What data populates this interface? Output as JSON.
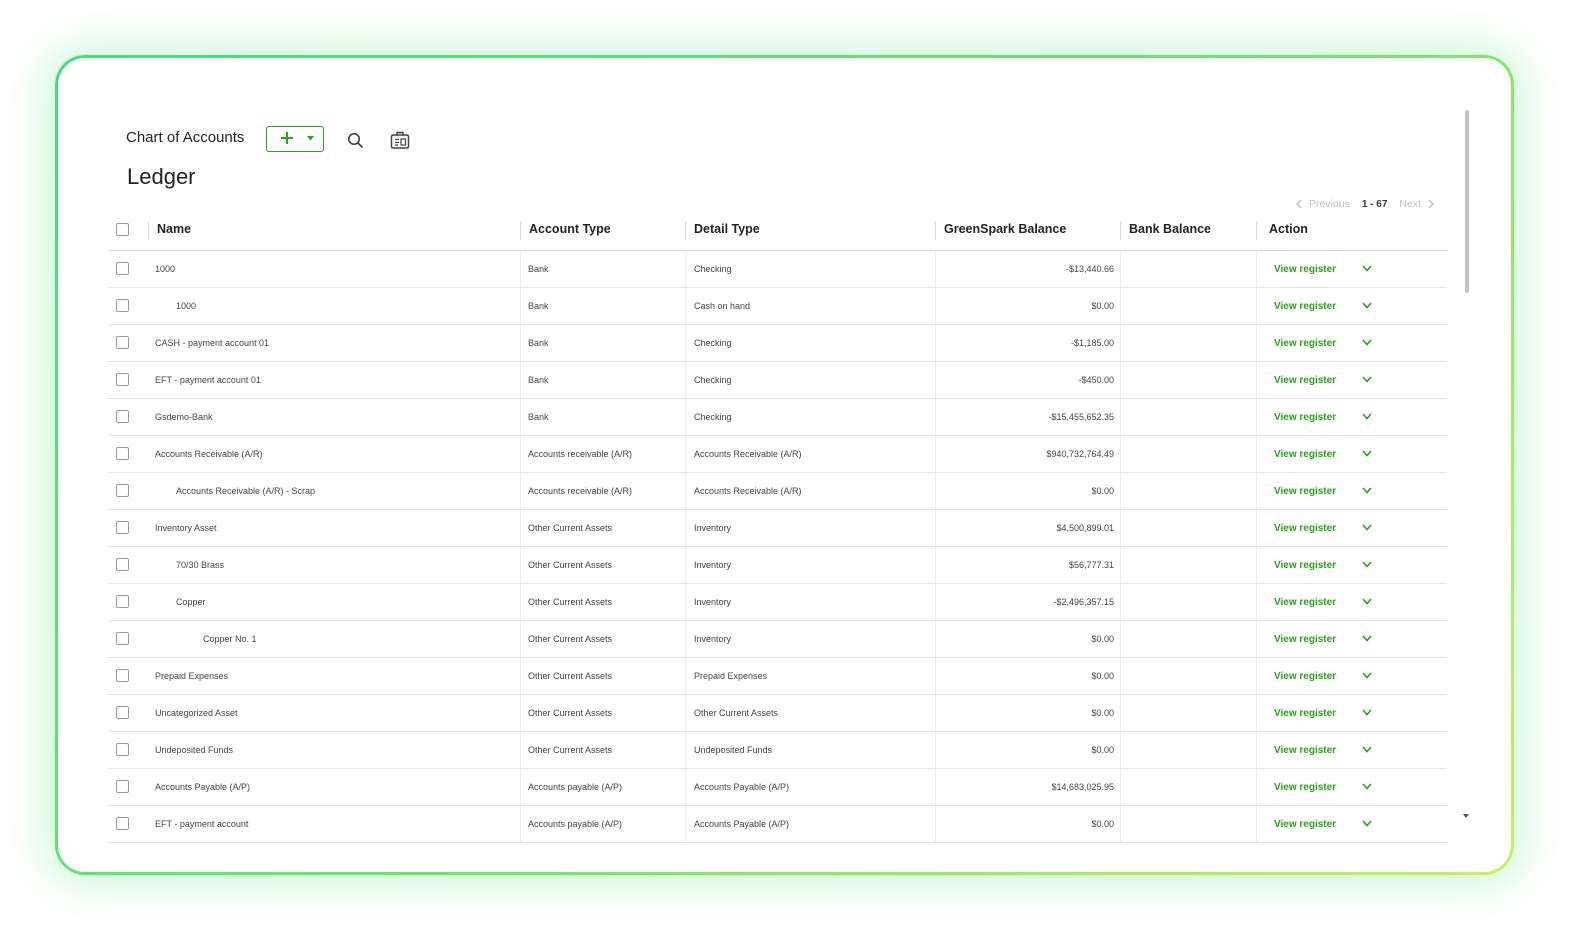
{
  "app_title": "Chart of Accounts",
  "page_title": "Ledger",
  "icons": {
    "new": "plus-icon",
    "new_dropdown": "caret-down-icon",
    "search": "search-icon",
    "report": "report-icon",
    "row_action": "chevron-down-icon"
  },
  "colors": {
    "accent_green": "#2ca01c",
    "frame_green": "#3ee07a",
    "frame_lime": "#c6f25a"
  },
  "pagination": {
    "previous": "Previous",
    "range": "1 - 67",
    "next": "Next"
  },
  "columns": {
    "name": "Name",
    "account_type": "Account Type",
    "detail_type": "Detail Type",
    "greenspark_balance": "GreenSpark Balance",
    "bank_balance": "Bank Balance",
    "action": "Action"
  },
  "rows": [
    {
      "name": "1000",
      "level": 0,
      "account_type": "Bank",
      "detail_type": "Checking",
      "balance": "-$13,440.66",
      "bank_balance": "",
      "action": "View register"
    },
    {
      "name": "1000",
      "level": 1,
      "account_type": "Bank",
      "detail_type": "Cash on hand",
      "balance": "$0.00",
      "bank_balance": "",
      "action": "View register"
    },
    {
      "name": "CASH - payment account 01",
      "level": 0,
      "account_type": "Bank",
      "detail_type": "Checking",
      "balance": "-$1,185.00",
      "bank_balance": "",
      "action": "View register"
    },
    {
      "name": "EFT - payment account 01",
      "level": 0,
      "account_type": "Bank",
      "detail_type": "Checking",
      "balance": "-$450.00",
      "bank_balance": "",
      "action": "View register"
    },
    {
      "name": "Gsdemo-Bank",
      "level": 0,
      "account_type": "Bank",
      "detail_type": "Checking",
      "balance": "-$15,455,652.35",
      "bank_balance": "",
      "action": "View register"
    },
    {
      "name": "Accounts Receivable (A/R)",
      "level": 0,
      "account_type": "Accounts receivable (A/R)",
      "detail_type": "Accounts Receivable (A/R)",
      "balance": "$940,732,764.49",
      "bank_balance": "",
      "action": "View register"
    },
    {
      "name": "Accounts Receivable (A/R) - Scrap",
      "level": 1,
      "account_type": "Accounts receivable (A/R)",
      "detail_type": "Accounts Receivable (A/R)",
      "balance": "$0.00",
      "bank_balance": "",
      "action": "View register"
    },
    {
      "name": "Inventory Asset",
      "level": 0,
      "account_type": "Other Current Assets",
      "detail_type": "Inventory",
      "balance": "$4,500,899.01",
      "bank_balance": "",
      "action": "View register"
    },
    {
      "name": "70/30 Brass",
      "level": 1,
      "account_type": "Other Current Assets",
      "detail_type": "Inventory",
      "balance": "$56,777.31",
      "bank_balance": "",
      "action": "View register"
    },
    {
      "name": "Copper",
      "level": 1,
      "account_type": "Other Current Assets",
      "detail_type": "Inventory",
      "balance": "-$2,496,357.15",
      "bank_balance": "",
      "action": "View register"
    },
    {
      "name": "Copper No. 1",
      "level": 2,
      "account_type": "Other Current Assets",
      "detail_type": "Inventory",
      "balance": "$0.00",
      "bank_balance": "",
      "action": "View register"
    },
    {
      "name": "Prepaid Expenses",
      "level": 0,
      "account_type": "Other Current Assets",
      "detail_type": "Prepaid Expenses",
      "balance": "$0.00",
      "bank_balance": "",
      "action": "View register"
    },
    {
      "name": "Uncategorized Asset",
      "level": 0,
      "account_type": "Other Current Assets",
      "detail_type": "Other Current Assets",
      "balance": "$0.00",
      "bank_balance": "",
      "action": "View register"
    },
    {
      "name": "Undeposited Funds",
      "level": 0,
      "account_type": "Other Current Assets",
      "detail_type": "Undeposited Funds",
      "balance": "$0.00",
      "bank_balance": "",
      "action": "View register"
    },
    {
      "name": "Accounts Payable (A/P)",
      "level": 0,
      "account_type": "Accounts payable (A/P)",
      "detail_type": "Accounts Payable (A/P)",
      "balance": "$14,683,025.95",
      "bank_balance": "",
      "action": "View register"
    },
    {
      "name": "EFT - payment account",
      "level": 0,
      "account_type": "Accounts payable (A/P)",
      "detail_type": "Accounts Payable (A/P)",
      "balance": "$0.00",
      "bank_balance": "",
      "action": "View register"
    }
  ]
}
